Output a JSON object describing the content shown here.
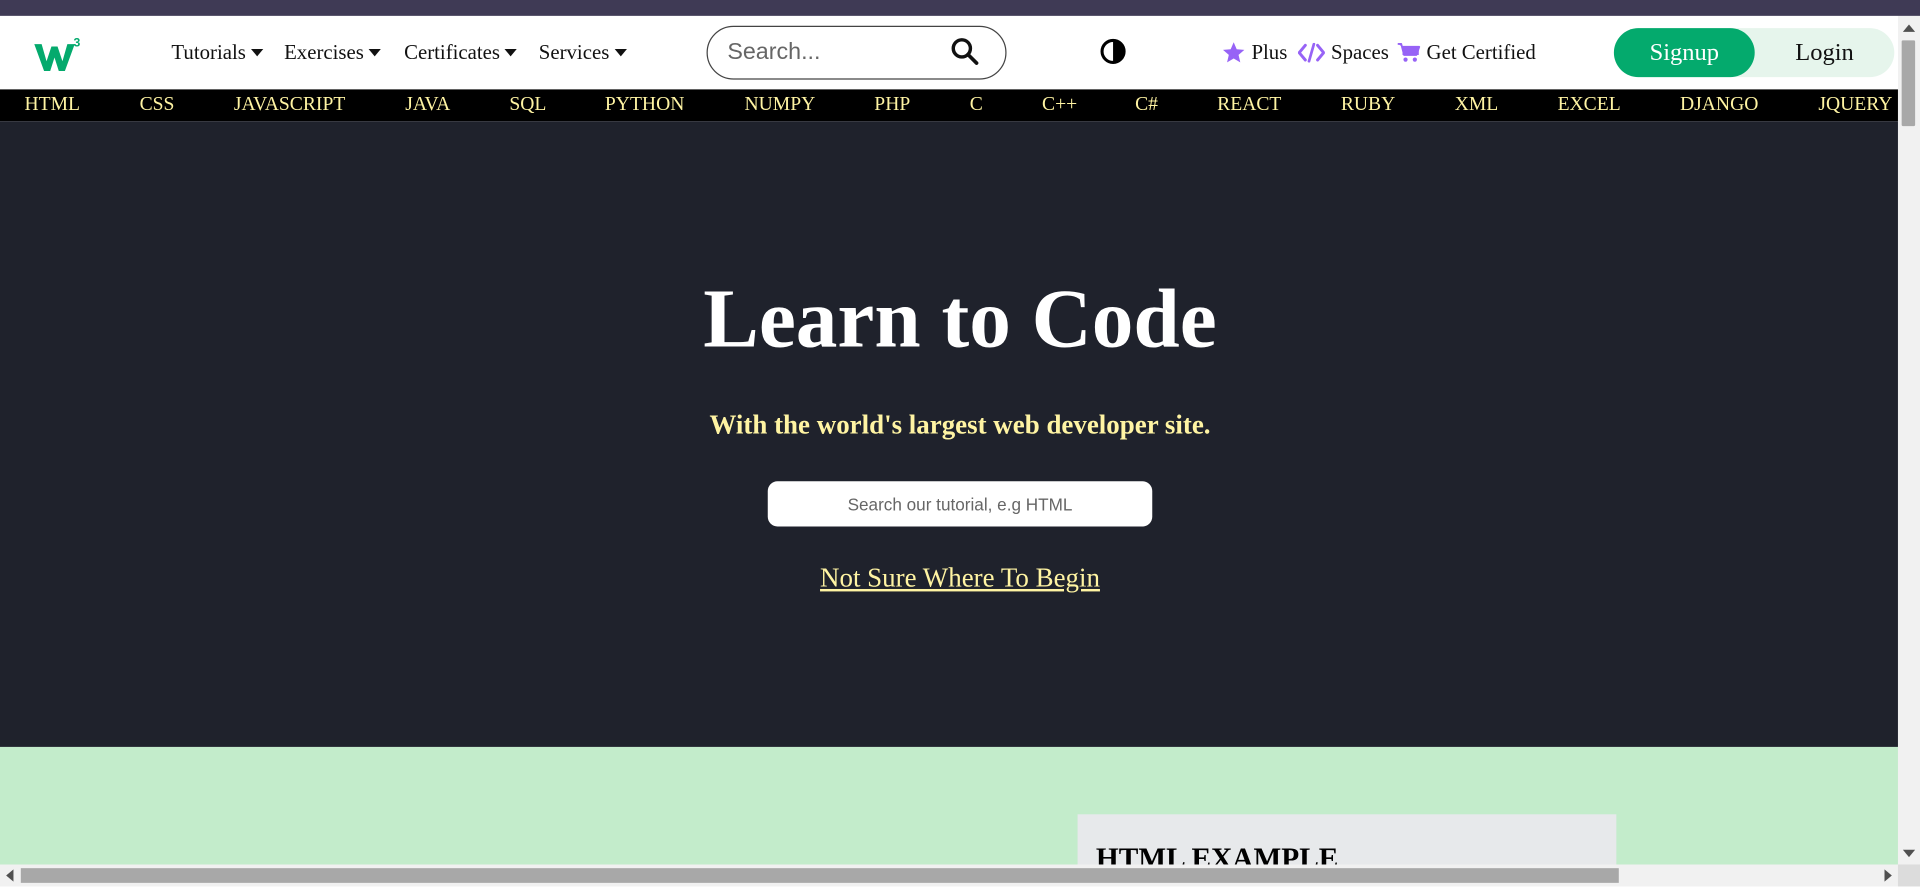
{
  "colors": {
    "brand_green": "#04aa6d",
    "hero_bg": "#1f222c",
    "accent_yellow": "#fff4a3",
    "section_green": "#c3eccb",
    "icon_purple": "#9763f6"
  },
  "navbar": {
    "logo_icon": "w3schools-logo-icon",
    "menus": [
      {
        "label": "Tutorials"
      },
      {
        "label": "Exercises"
      },
      {
        "label": "Certificates"
      },
      {
        "label": "Services"
      }
    ],
    "search": {
      "placeholder": "Search...",
      "icon": "search-icon"
    },
    "theme_toggle_icon": "contrast-icon",
    "links": {
      "plus": "Plus",
      "spaces": "Spaces",
      "get_certified": "Get Certified"
    },
    "signup_label": "Signup",
    "login_label": "Login"
  },
  "subnav": {
    "items": [
      "HTML",
      "CSS",
      "JAVASCRIPT",
      "JAVA",
      "SQL",
      "PYTHON",
      "NUMPY",
      "PHP",
      "C",
      "C++",
      "C#",
      "REACT",
      "RUBY",
      "XML",
      "EXCEL",
      "DJANGO",
      "JQUERY"
    ]
  },
  "hero": {
    "title": "Learn to Code",
    "subtitle": "With the world's largest web developer site.",
    "search_placeholder": "Search our tutorial, e.g HTML",
    "begin_link": "Not Sure Where To Begin"
  },
  "example_section": {
    "title": "HTML EXAMPLE"
  }
}
